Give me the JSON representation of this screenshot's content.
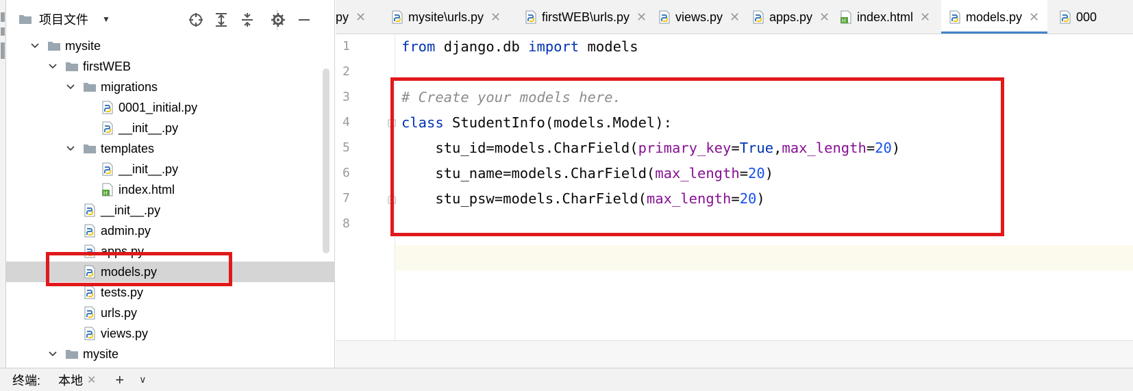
{
  "project_panel": {
    "title": "项目文件",
    "tree": [
      {
        "name": "mysite",
        "type": "folder",
        "depth": 1,
        "expanded": true
      },
      {
        "name": "firstWEB",
        "type": "folder",
        "depth": 2,
        "expanded": true
      },
      {
        "name": "migrations",
        "type": "folder",
        "depth": 3,
        "expanded": true
      },
      {
        "name": "0001_initial.py",
        "type": "python",
        "depth": 4
      },
      {
        "name": "__init__.py",
        "type": "python",
        "depth": 4
      },
      {
        "name": "templates",
        "type": "folder",
        "depth": 3,
        "expanded": true
      },
      {
        "name": "__init__.py",
        "type": "python",
        "depth": 4
      },
      {
        "name": "index.html",
        "type": "html",
        "depth": 4
      },
      {
        "name": "__init__.py",
        "type": "python",
        "depth": 3
      },
      {
        "name": "admin.py",
        "type": "python",
        "depth": 3
      },
      {
        "name": "apps.py",
        "type": "python",
        "depth": 3
      },
      {
        "name": "models.py",
        "type": "python",
        "depth": 3,
        "selected": true
      },
      {
        "name": "tests.py",
        "type": "python",
        "depth": 3
      },
      {
        "name": "urls.py",
        "type": "python",
        "depth": 3
      },
      {
        "name": "views.py",
        "type": "python",
        "depth": 3
      },
      {
        "name": "mysite",
        "type": "folder",
        "depth": 2,
        "expanded": true
      }
    ]
  },
  "tabs": [
    {
      "label": "py",
      "icon": "none",
      "active": false
    },
    {
      "label": "mysite\\urls.py",
      "icon": "python",
      "active": false
    },
    {
      "label": "firstWEB\\urls.py",
      "icon": "python",
      "active": false
    },
    {
      "label": "views.py",
      "icon": "python",
      "active": false
    },
    {
      "label": "apps.py",
      "icon": "python",
      "active": false
    },
    {
      "label": "index.html",
      "icon": "html",
      "active": false
    },
    {
      "label": "models.py",
      "icon": "python",
      "active": true
    },
    {
      "label": "000",
      "icon": "python",
      "active": false
    }
  ],
  "editor": {
    "line_numbers": [
      "1",
      "2",
      "3",
      "4",
      "5",
      "6",
      "7",
      "8"
    ],
    "code": {
      "l1_from": "from",
      "l1_mod": " django.db ",
      "l1_import": "import",
      "l1_name": " models",
      "l3_comment": "# Create your models here.",
      "l4_class": "class",
      "l4_rest": " StudentInfo(models.Model):",
      "l5_a": "    stu_id=models.CharField(",
      "l5_p1": "primary_key",
      "l5_eq1": "=",
      "l5_true": "True",
      "l5_comma": ",",
      "l5_p2": "max_length",
      "l5_eq2": "=",
      "l5_num": "20",
      "l5_end": ")",
      "l6_a": "    stu_name=models.CharField(",
      "l6_p": "max_length",
      "l6_eq": "=",
      "l6_num": "20",
      "l6_end": ")",
      "l7_a": "    stu_psw=models.CharField(",
      "l7_p": "max_length",
      "l7_eq": "=",
      "l7_num": "20",
      "l7_end": ")"
    }
  },
  "terminal": {
    "label": "终端:",
    "tab": "本地",
    "add": "+",
    "more": "∨"
  },
  "colors": {
    "highlight_red": "#e0191b",
    "keyword_blue": "#0033b3",
    "param_purple": "#871094",
    "number_blue": "#1750eb",
    "active_tab_underline": "#4083c9",
    "selection_gray": "#d5d5d5"
  }
}
